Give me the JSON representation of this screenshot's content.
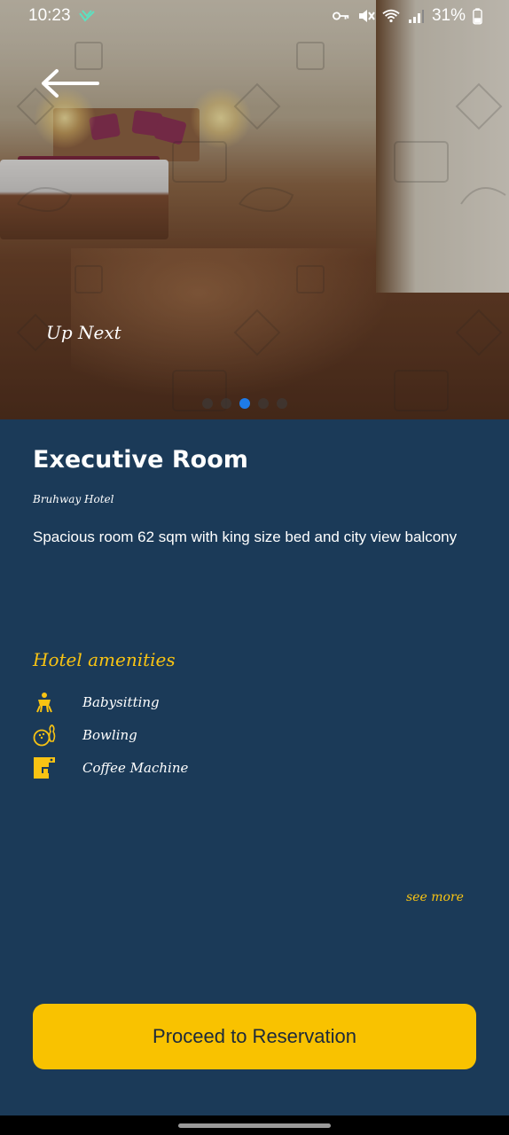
{
  "status_bar": {
    "time": "10:23",
    "battery": "31%",
    "icons": [
      "vpn-key-icon",
      "mute-icon",
      "wifi-icon",
      "signal-icon",
      "battery-icon"
    ]
  },
  "hero": {
    "up_next_label": "Up Next",
    "carousel_dots": 5,
    "active_dot_index": 2
  },
  "room": {
    "title": "Executive Room",
    "hotel": "Bruhway Hotel",
    "description": "Spacious room 62 sqm with king size bed and city view balcony"
  },
  "amenities": {
    "title": "Hotel amenities",
    "items": [
      {
        "label": "Babysitting",
        "icon": "baby-chair-icon"
      },
      {
        "label": "Bowling",
        "icon": "bowling-icon"
      },
      {
        "label": "Coffee Machine",
        "icon": "coffee-machine-icon"
      }
    ],
    "see_more_label": "see more"
  },
  "cta": {
    "label": "Proceed to Reservation"
  },
  "colors": {
    "background": "#1b3a58",
    "accent": "#f9c200",
    "active_dot": "#1e7be8"
  }
}
